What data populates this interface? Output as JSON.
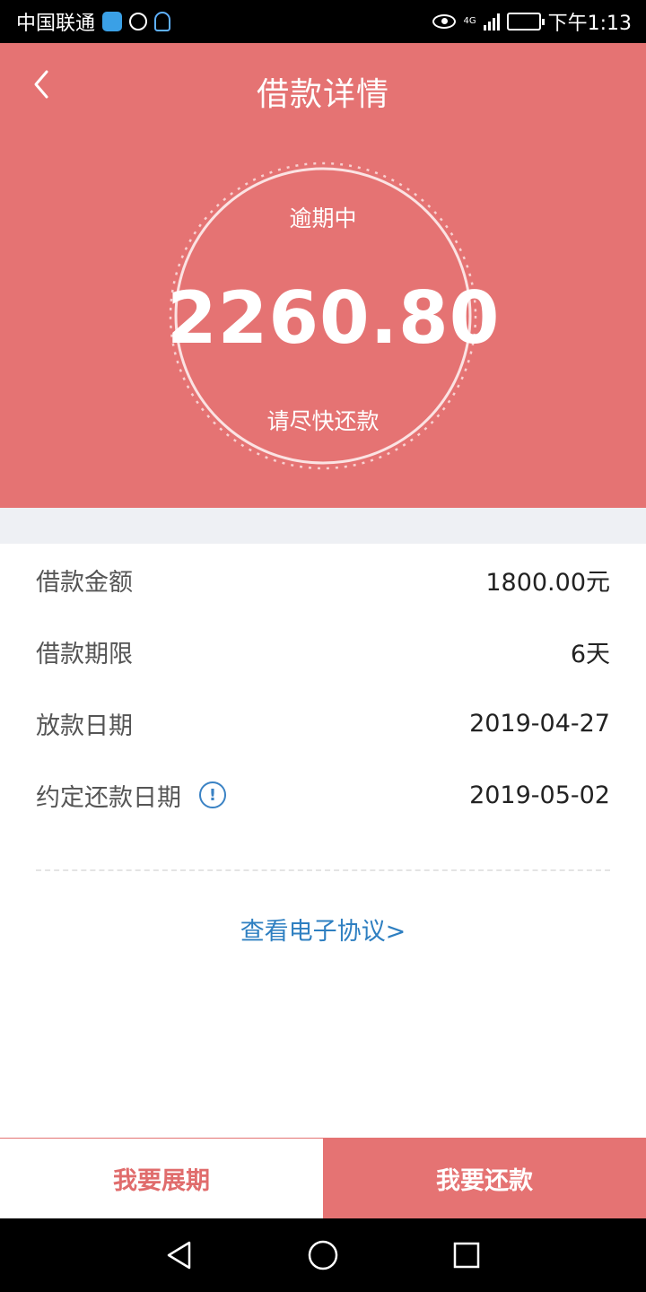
{
  "status_bar": {
    "carrier": "中国联通",
    "network": "4G",
    "time": "下午1:13",
    "icons": [
      "app-icon",
      "app-icon",
      "qq-icon",
      "eye-icon",
      "signal-icon",
      "battery-icon"
    ]
  },
  "header": {
    "title": "借款详情",
    "back_icon": "chevron-left-icon"
  },
  "loan_summary": {
    "status": "逾期中",
    "amount": "2260.80",
    "hint": "请尽快还款"
  },
  "details": {
    "rows": [
      {
        "label": "借款金额",
        "value": "1800.00元"
      },
      {
        "label": "借款期限",
        "value": "6天"
      },
      {
        "label": "放款日期",
        "value": "2019-04-27"
      },
      {
        "label": "约定还款日期",
        "value": "2019-05-02"
      }
    ],
    "info_icon": "info-icon"
  },
  "agreement_link": "查看电子协议>",
  "actions": {
    "extend_label": "我要展期",
    "repay_label": "我要还款"
  },
  "colors": {
    "primary": "#e57373",
    "link": "#2e7fc1",
    "band": "#eef0f4"
  },
  "nav_bar": {
    "icons": [
      "back-triangle-icon",
      "home-circle-icon",
      "recents-square-icon"
    ]
  }
}
